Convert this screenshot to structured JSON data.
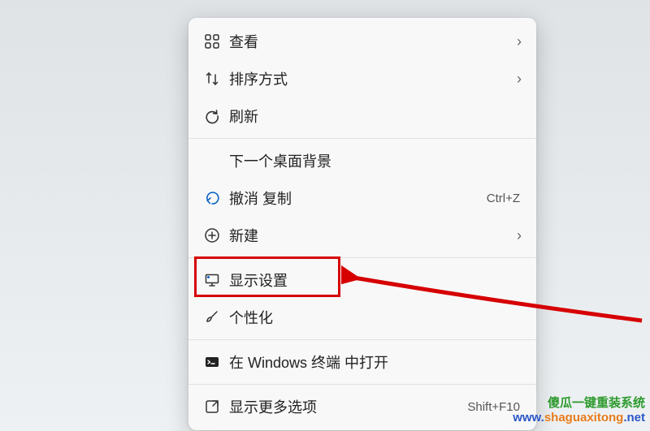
{
  "menu": {
    "groups": [
      [
        {
          "id": "view",
          "icon": "grid-icon",
          "label": "查看",
          "submenu": true
        },
        {
          "id": "sort",
          "icon": "sort-icon",
          "label": "排序方式",
          "submenu": true
        },
        {
          "id": "refresh",
          "icon": "refresh-icon",
          "label": "刷新"
        }
      ],
      [
        {
          "id": "next-bg",
          "icon": null,
          "label": "下一个桌面背景"
        },
        {
          "id": "undo-copy",
          "icon": "undo-icon",
          "label": "撤消 复制",
          "accel": "Ctrl+Z"
        },
        {
          "id": "new",
          "icon": "plus-circle-icon",
          "label": "新建",
          "submenu": true
        }
      ],
      [
        {
          "id": "display-settings",
          "icon": "display-icon",
          "label": "显示设置",
          "highlighted": true
        },
        {
          "id": "personalize",
          "icon": "brush-icon",
          "label": "个性化"
        }
      ],
      [
        {
          "id": "open-terminal",
          "icon": "terminal-icon",
          "label": "在 Windows 终端 中打开"
        }
      ],
      [
        {
          "id": "more-options",
          "icon": "more-options-icon",
          "label": "显示更多选项",
          "accel": "Shift+F10"
        }
      ]
    ]
  },
  "watermark": {
    "line1": "傻瓜一键重装系统",
    "line2_prefix": "www.",
    "line2_domain": "shaguaxitong",
    "line2_suffix": ".net"
  }
}
